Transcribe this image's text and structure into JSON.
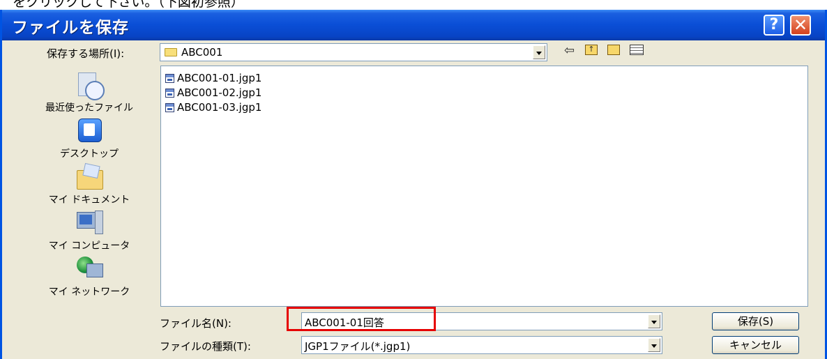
{
  "caption": "をクリックして下さい。（下図初参照）",
  "window": {
    "title": "ファイルを保存",
    "help_glyph": "?",
    "close_glyph": "✕"
  },
  "location": {
    "label": "保存する場所(I):",
    "value": "ABC001"
  },
  "toolbar_icons": [
    "back-arrow-icon",
    "up-folder-icon",
    "new-folder-icon",
    "view-menu-icon"
  ],
  "places": [
    {
      "label": "最近使ったファイル",
      "icon": "recent-files-icon"
    },
    {
      "label": "デスクトップ",
      "icon": "desktop-icon"
    },
    {
      "label": "マイ ドキュメント",
      "icon": "my-documents-icon"
    },
    {
      "label": "マイ コンピュータ",
      "icon": "my-computer-icon"
    },
    {
      "label": "マイ ネットワーク",
      "icon": "my-network-icon"
    }
  ],
  "files": [
    "ABC001-01.jgp1",
    "ABC001-02.jgp1",
    "ABC001-03.jgp1"
  ],
  "filename": {
    "label": "ファイル名(N):",
    "value": "ABC001-01回答"
  },
  "filetype": {
    "label": "ファイルの種類(T):",
    "value": "JGP1ファイル(*.jgp1)"
  },
  "buttons": {
    "save": "保存(S)",
    "cancel": "キャンセル"
  },
  "colors": {
    "title_bar": "#0a4ed6",
    "dialog_bg": "#ece9d8",
    "highlight": "#e60000"
  }
}
